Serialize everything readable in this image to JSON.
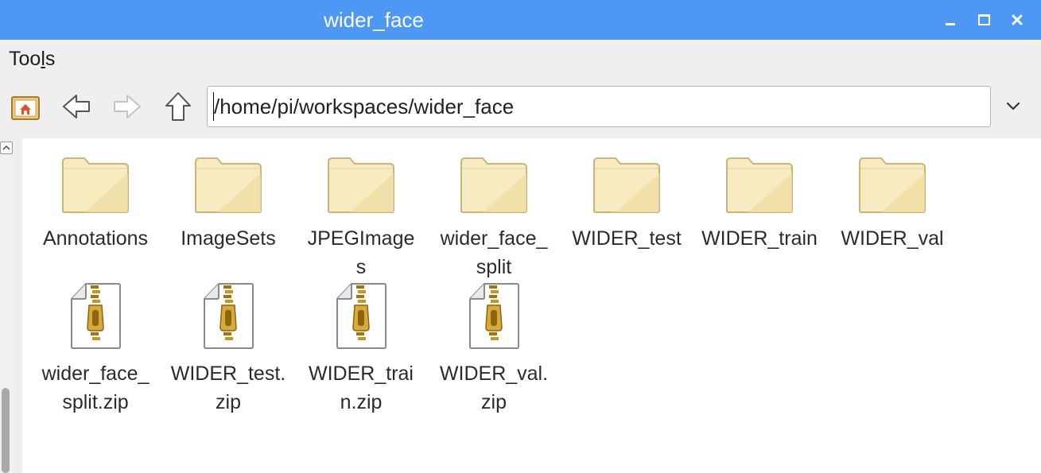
{
  "window": {
    "title": "wider_face"
  },
  "menu": {
    "tools_prefix": "Too",
    "tools_underlined": "l",
    "tools_suffix": "s"
  },
  "toolbar": {
    "path_value": "/home/pi/workspaces/wider_face"
  },
  "files": [
    {
      "label": "Annotations",
      "type": "folder"
    },
    {
      "label": "ImageSets",
      "type": "folder"
    },
    {
      "label": "JPEGImage\ns",
      "type": "folder"
    },
    {
      "label": "wider_face_\nsplit",
      "type": "folder"
    },
    {
      "label": "WIDER_test",
      "type": "folder"
    },
    {
      "label": "WIDER_train",
      "type": "folder"
    },
    {
      "label": "WIDER_val",
      "type": "folder"
    },
    {
      "label": "wider_face_\nsplit.zip",
      "type": "zip"
    },
    {
      "label": "WIDER_test.\nzip",
      "type": "zip"
    },
    {
      "label": "WIDER_trai\nn.zip",
      "type": "zip"
    },
    {
      "label": "WIDER_val.\nzip",
      "type": "zip"
    }
  ],
  "colors": {
    "titlebar": "#4d98f5",
    "folder_fill": "#f7ebc2",
    "folder_edge": "#c9b77a"
  },
  "icons": {
    "home": "home-icon",
    "back": "arrow-left-icon",
    "forward": "arrow-right-icon",
    "up": "arrow-up-icon",
    "dropdown": "chevron-down-icon",
    "folder": "folder-icon",
    "zip": "zip-archive-icon"
  }
}
